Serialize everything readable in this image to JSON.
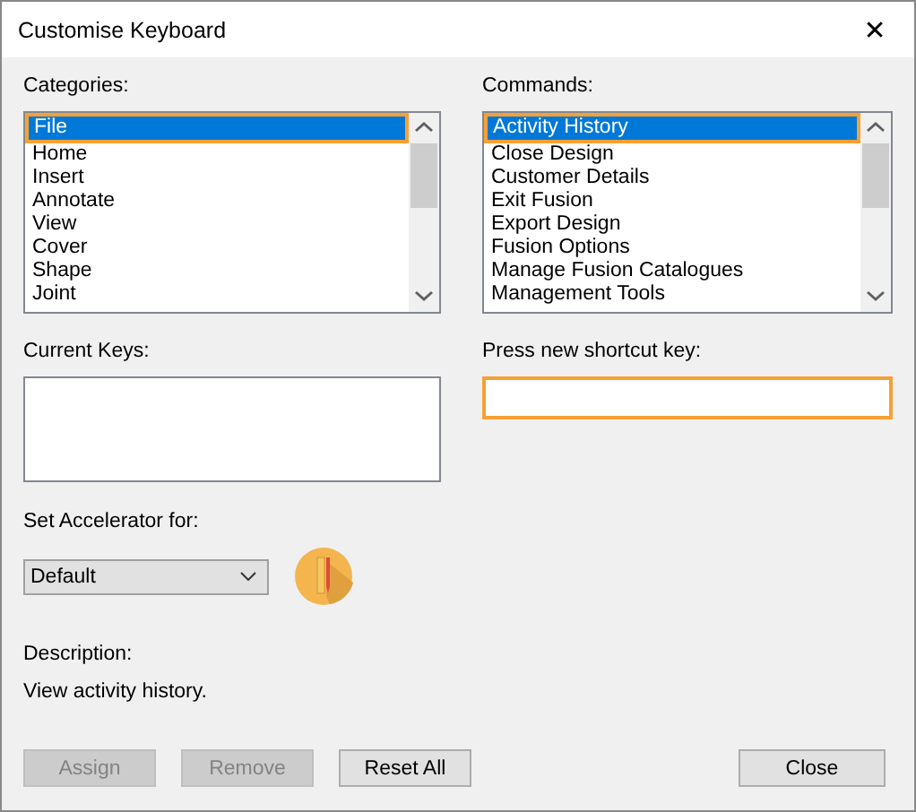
{
  "window": {
    "title": "Customise Keyboard",
    "close": "✕"
  },
  "categories": {
    "label": "Categories:",
    "items": [
      {
        "text": "File",
        "selected": true
      },
      {
        "text": "Home",
        "selected": false
      },
      {
        "text": "Insert",
        "selected": false
      },
      {
        "text": "Annotate",
        "selected": false
      },
      {
        "text": "View",
        "selected": false
      },
      {
        "text": "Cover",
        "selected": false
      },
      {
        "text": "Shape",
        "selected": false
      },
      {
        "text": "Joint",
        "selected": false
      }
    ]
  },
  "commands": {
    "label": "Commands:",
    "items": [
      {
        "text": "Activity History",
        "selected": true
      },
      {
        "text": "Close Design",
        "selected": false
      },
      {
        "text": "Customer Details",
        "selected": false
      },
      {
        "text": "Exit Fusion",
        "selected": false
      },
      {
        "text": "Export Design",
        "selected": false
      },
      {
        "text": "Fusion Options",
        "selected": false
      },
      {
        "text": "Manage Fusion Catalogues",
        "selected": false
      },
      {
        "text": "Management Tools",
        "selected": false
      }
    ]
  },
  "current_keys": {
    "label": "Current Keys:"
  },
  "shortcut": {
    "label": "Press new shortcut key:"
  },
  "accelerator": {
    "label": "Set Accelerator for:",
    "value": "Default"
  },
  "description": {
    "label": "Description:",
    "text": "View activity history."
  },
  "buttons": [
    {
      "label": "Assign",
      "disabled": true
    },
    {
      "label": "Remove",
      "disabled": true
    },
    {
      "label": "Reset All",
      "disabled": false
    },
    {
      "label": "Close",
      "disabled": false
    }
  ]
}
